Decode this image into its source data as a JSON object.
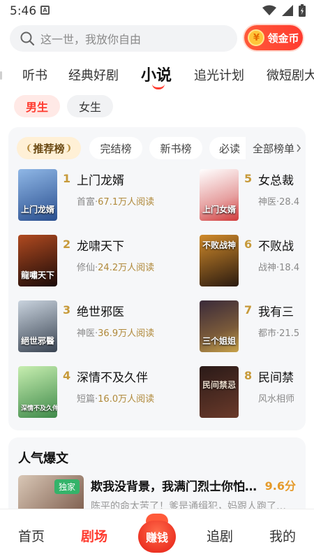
{
  "status_bar": {
    "time": "5:46",
    "app_icon_letter": "A"
  },
  "search": {
    "placeholder": "这一世，我放你自由",
    "coin_symbol": "¥",
    "coin_label": "领金币"
  },
  "tabs": [
    "听书",
    "经典好剧",
    "小说",
    "追光计划",
    "微短剧大"
  ],
  "active_tab": "小说",
  "gender": {
    "male": "男生",
    "female": "女生"
  },
  "rank_tabs": {
    "items": [
      "推荐榜",
      "完结榜",
      "新书榜",
      "必读"
    ],
    "all_label": "全部榜单"
  },
  "books": [
    {
      "rank": "1",
      "title": "上门龙婿",
      "genre": "首富",
      "reads": "67.1万人阅读",
      "cover_text": "上门龙婿",
      "cover_colors": [
        "#8fb7e6",
        "#2a4f8f"
      ]
    },
    {
      "rank": "2",
      "title": "龙啸天下",
      "genre": "修仙",
      "reads": "24.2万人阅读",
      "cover_text": "龍嘯天下",
      "cover_colors": [
        "#7a2a18",
        "#1a0a08"
      ]
    },
    {
      "rank": "3",
      "title": "绝世邪医",
      "genre": "神医",
      "reads": "36.9万人阅读",
      "cover_text": "絕世邪醫",
      "cover_colors": [
        "#c9d3de",
        "#3a4452"
      ]
    },
    {
      "rank": "4",
      "title": "深情不及久伴",
      "genre": "短篇",
      "reads": "16.0万人阅读",
      "cover_text": "深情不及久伴",
      "cover_colors": [
        "#b7e3a0",
        "#3f8a4a"
      ]
    },
    {
      "rank": "5",
      "title": "女总裁",
      "genre": "神医",
      "reads": "28.4",
      "cover_text": "上门女婿",
      "cover_colors": [
        "#ffffff",
        "#d13a3a"
      ]
    },
    {
      "rank": "6",
      "title": "不败战",
      "genre": "战神",
      "reads": "18.4",
      "cover_text": "不败战神",
      "cover_colors": [
        "#d08a2a",
        "#2a1a10"
      ]
    },
    {
      "rank": "7",
      "title": "我有三",
      "genre": "都市",
      "reads": "21.5",
      "cover_text": "三个姐姐",
      "cover_colors": [
        "#3a2a3a",
        "#c7a24a"
      ]
    },
    {
      "rank": "8",
      "title": "民间禁",
      "genre": "风水相师",
      "reads": "",
      "cover_text": "民间禁忌",
      "cover_colors": [
        "#2a1a18",
        "#6a3a2a"
      ]
    }
  ],
  "popular": {
    "section_title": "人气爆文",
    "badge": "独家",
    "book_title": "欺我没背景，我满门烈士你怕…",
    "score": "9.6分",
    "description": "陈平的命太苦了！爹是通缉犯，妈跟人跑了…"
  },
  "bottom_nav": {
    "home": "首页",
    "theater": "剧场",
    "earn": "赚钱",
    "follow": "追剧",
    "mine": "我的"
  },
  "colors": {
    "accent": "#ff3b2f",
    "gold": "#c79a3a"
  }
}
